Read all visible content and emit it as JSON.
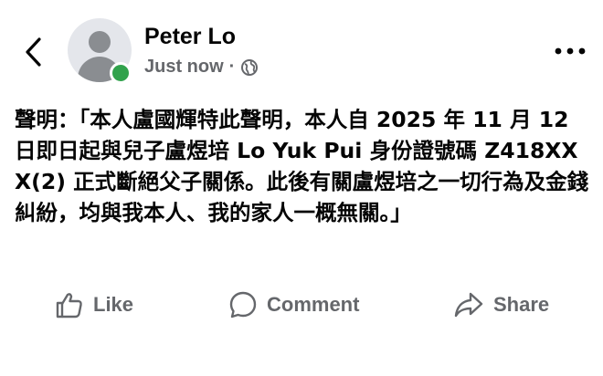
{
  "post": {
    "author_name": "Peter Lo",
    "timestamp": "Just now",
    "meta_separator": "·",
    "privacy_icon": "globe-icon",
    "text": "聲明：「本人盧國輝特此聲明，本人自 2025 年 11 月 12 日即日起與兒子盧煜培 Lo Yuk Pui 身份證號碼 Z418XXX(2) 正式斷絕父子關係。此後有關盧煜培之一切行為及金錢糾紛，均與我本人、我的家人一概無關。」"
  },
  "header": {
    "back_icon": "chevron-left-icon",
    "more_icon": "more-horizontal-icon",
    "online_status_color": "#31a24c"
  },
  "actions": {
    "like_label": "Like",
    "comment_label": "Comment",
    "share_label": "Share"
  },
  "colors": {
    "text_primary": "#050505",
    "text_secondary": "#65676b",
    "background": "#ffffff"
  }
}
